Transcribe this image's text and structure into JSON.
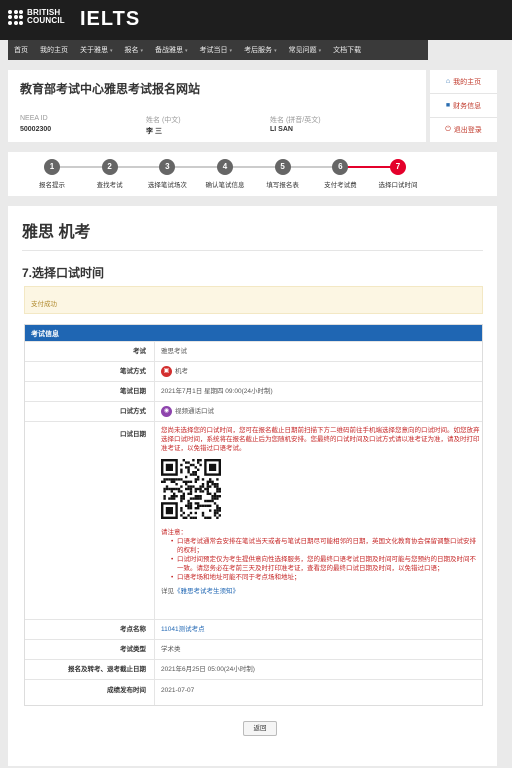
{
  "brand": {
    "org_line1": "BRITISH",
    "org_line2": "COUNCIL",
    "product": "IELTS"
  },
  "nav": [
    "首页",
    "我的主页",
    "关于雅思",
    "报名",
    "备战雅思",
    "考试当日",
    "考后服务",
    "常见问题",
    "文档下载"
  ],
  "nav_dropdowns": [
    false,
    false,
    true,
    true,
    true,
    true,
    true,
    true,
    false
  ],
  "site_title": "教育部考试中心雅思考试报名网站",
  "user": {
    "neea_label": "NEEA ID",
    "neea_value": "50002300",
    "name_cn_label": "姓名 (中文)",
    "name_cn_value": "李 三",
    "name_py_label": "姓名 (拼音/英文)",
    "name_py_value": "LI SAN"
  },
  "side_menu": [
    {
      "icon": "home-icon",
      "glyph": "⌂",
      "label": "我的主页"
    },
    {
      "icon": "briefcase-icon",
      "glyph": "■",
      "label": "财务信息"
    },
    {
      "icon": "power-icon",
      "glyph": "⏻",
      "label": "退出登录"
    }
  ],
  "steps": [
    {
      "num": "1",
      "label": "报名提示"
    },
    {
      "num": "2",
      "label": "查找考试"
    },
    {
      "num": "3",
      "label": "选择笔试场次"
    },
    {
      "num": "4",
      "label": "确认笔试信息"
    },
    {
      "num": "5",
      "label": "填写报名表"
    },
    {
      "num": "6",
      "label": "支付考试费"
    },
    {
      "num": "7",
      "label": "选择口试时间"
    }
  ],
  "active_step": 7,
  "page_heading": "雅思 机考",
  "section_heading": "7.选择口试时间",
  "alert": "支付成功",
  "panel_title": "考试信息",
  "rows": {
    "exam": {
      "label": "考试",
      "value": "雅思考试"
    },
    "method": {
      "label": "笔试方式",
      "value": "机考"
    },
    "date": {
      "label": "笔试日期",
      "value": "2021年7月1日 星期四 09:00(24小时制)"
    },
    "oral_method": {
      "label": "口试方式",
      "value": "视频通话口试"
    },
    "oral_date": {
      "label": "口试日期"
    },
    "center": {
      "label": "考点名称",
      "value": "11041测试考点"
    },
    "type": {
      "label": "考试类型",
      "value": "学术类"
    },
    "deadline": {
      "label": "报名及转考、退考截止日期",
      "value": "2021年6月25日 05:00(24小时制)"
    },
    "release": {
      "label": "成绩发布时间",
      "value": "2021-07-07"
    }
  },
  "oral_text": "您尚未选择您的口试时间，您可在报名截止日期前扫描下方二维码前往手机端选择您意向的口试时间。如您放弃选择口试时间，系统将在报名截止后为您随机安排。您最终的口试时间及口试方式请以准考证为准，请及时打印准考证，以免错过口语考试。",
  "notice_title": "请注意：",
  "notices": [
    "口语考试通常会安排在笔试当天或者与笔试日期尽可能相邻的日期，英国文化教育协会保留调整口试安排的权利；",
    "口试时间预定仅为考生提供意向性选择服务，您的最终口语考试日期及时间可能与您预约的日期及时间不一致。请您务必在考前三天及时打印准考证，查看您的最终口试日期及时间，以免错过口语；",
    "口语考场和地址可能不同于考点场和地址；"
  ],
  "notice_link_prefix": "详见",
  "notice_link": "《雅思考试考生须知》",
  "back_button": "返回",
  "colors": {
    "accent_red": "#e4002b",
    "panel_blue": "#1f66b3",
    "alert_bg": "#fcf6e3"
  }
}
